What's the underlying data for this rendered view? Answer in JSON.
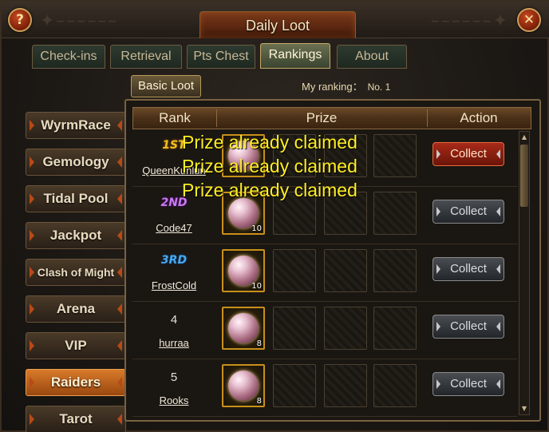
{
  "window": {
    "title": "Daily Loot"
  },
  "buttons": {
    "help": "?",
    "close": "✕"
  },
  "tabs": [
    {
      "label": "Check-ins"
    },
    {
      "label": "Retrieval"
    },
    {
      "label": "Pts Chest"
    },
    {
      "label": "Rankings",
      "active": true
    },
    {
      "label": "About"
    }
  ],
  "subtab": {
    "label": "Basic Loot"
  },
  "my_ranking": {
    "label": "My ranking：",
    "value": "No. 1"
  },
  "sidebar": {
    "items": [
      {
        "label": "WyrmRace"
      },
      {
        "label": "Gemology"
      },
      {
        "label": "Tidal Pool"
      },
      {
        "label": "Jackpot"
      },
      {
        "label": "Clash of Might"
      },
      {
        "label": "Arena"
      },
      {
        "label": "VIP"
      },
      {
        "label": "Raiders",
        "active": true
      },
      {
        "label": "Tarot"
      }
    ]
  },
  "table": {
    "headers": {
      "rank": "Rank",
      "prize": "Prize",
      "action": "Action"
    },
    "rows": [
      {
        "rank": "1ST",
        "player": "QueenKunlun",
        "qty": "",
        "action": "Collect",
        "active": true
      },
      {
        "rank": "2ND",
        "player": "Code47",
        "qty": "10",
        "action": "Collect"
      },
      {
        "rank": "3RD",
        "player": "FrostCold",
        "qty": "10",
        "action": "Collect"
      },
      {
        "rank": "4",
        "player": "hurraa",
        "qty": "8",
        "action": "Collect"
      },
      {
        "rank": "5",
        "player": "Rooks",
        "qty": "8",
        "action": "Collect"
      }
    ]
  },
  "notifications": [
    "Prize already claimed",
    "Prize already claimed",
    "Prize already claimed"
  ],
  "colors": {
    "rank1": "#f0c020",
    "rank2": "#c878f0",
    "rank3": "#48a8f0",
    "claimed": "#ffee22"
  }
}
